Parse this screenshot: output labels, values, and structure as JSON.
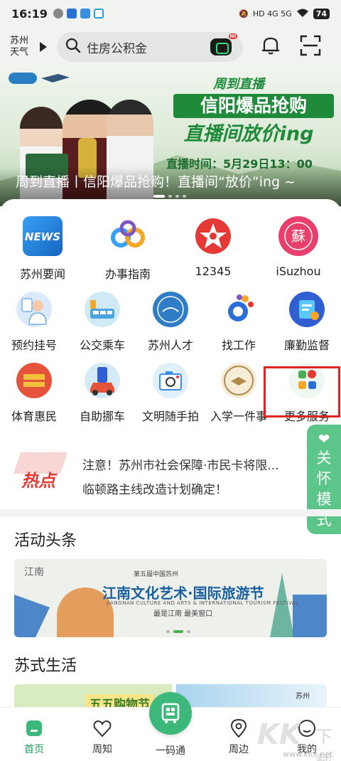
{
  "status_bar": {
    "time": "16:19",
    "network": "HD 4G 5G",
    "battery": "74"
  },
  "header": {
    "weather_line1": "苏州",
    "weather_line2": "天气",
    "search_text": "住房公积金"
  },
  "banner": {
    "caption": "周到直播丨信阳爆品抢购！直播间“放价”ing ~",
    "logo_text": "周到直播",
    "headline1": "信阳爆品抢购",
    "headline2": "直播间放价ing",
    "time_text": "直播时间：5月29日13：00"
  },
  "services": {
    "row1": [
      {
        "label": "苏州要闻",
        "icon": "news-icon"
      },
      {
        "label": "办事指南",
        "icon": "guide-icon"
      },
      {
        "label": "12345",
        "icon": "hotline-icon"
      },
      {
        "label": "iSuzhou",
        "icon": "isuzhou-icon"
      }
    ],
    "row2": [
      {
        "label": "预约挂号",
        "icon": "doctor-icon"
      },
      {
        "label": "公交乘车",
        "icon": "bus-icon"
      },
      {
        "label": "苏州人才",
        "icon": "talent-icon"
      },
      {
        "label": "找工作",
        "icon": "job-icon"
      },
      {
        "label": "廉勤监督",
        "icon": "supervision-icon"
      }
    ],
    "row3": [
      {
        "label": "体育惠民",
        "icon": "sports-icon"
      },
      {
        "label": "自助挪车",
        "icon": "car-icon"
      },
      {
        "label": "文明随手拍",
        "icon": "camera-icon"
      },
      {
        "label": "入学一件事",
        "icon": "education-icon"
      },
      {
        "label": "更多服务",
        "icon": "more-services-icon"
      }
    ]
  },
  "care_mode": {
    "label_chars": [
      "关",
      "怀",
      "模",
      "式"
    ]
  },
  "hot_news": {
    "badge": "热点",
    "items": [
      "注意！苏州市社会保障·市民卡将限...",
      "临顿路主线改造计划确定！"
    ]
  },
  "activity": {
    "section_title": "活动头条",
    "banner_title": "江南文化艺术·国际旅游节",
    "banner_subtitle": "第五届中国苏州",
    "banner_english": "JIANGNAN CULTURE AND ARTS & INTERNATIONAL TOURISM FESTIVAL",
    "banner_slogan": "最是江南 最美窗口",
    "banner_logo": "江南"
  },
  "life": {
    "section_title": "苏式生活",
    "banner_text": "五五购物节",
    "right_text": "苏州"
  },
  "bottom_nav": {
    "items": [
      {
        "label": "首页",
        "icon": "home-icon"
      },
      {
        "label": "周知",
        "icon": "heart-icon"
      },
      {
        "label": "一码通",
        "icon": "qr-code-icon"
      },
      {
        "label": "周边",
        "icon": "location-icon"
      },
      {
        "label": "我的",
        "icon": "profile-icon"
      }
    ]
  },
  "watermark": {
    "letters": "KK",
    "text": "下载",
    "url": "www.kkx.net"
  },
  "colors": {
    "accent_green": "#3cb97a",
    "highlight_red": "#e02424",
    "hot_red": "#e53935"
  }
}
